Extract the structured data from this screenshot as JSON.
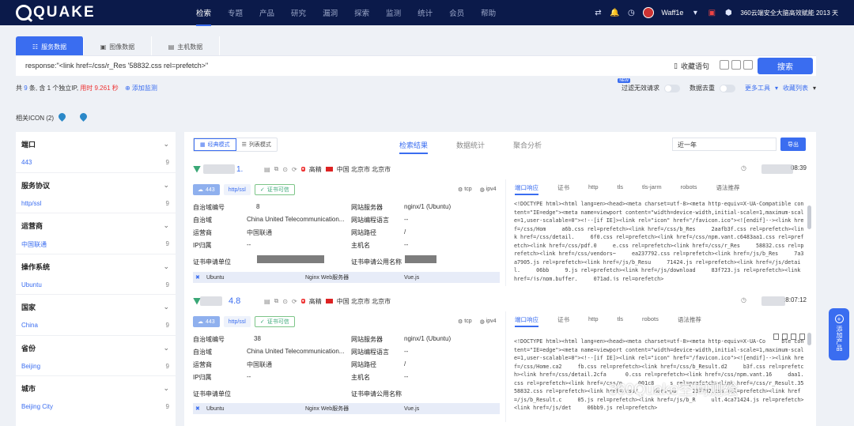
{
  "brand": {
    "name": "QUAKE"
  },
  "nav": {
    "items": [
      "检索",
      "专题",
      "产品",
      "研究",
      "漏洞",
      "探索",
      "监测",
      "统计",
      "会员",
      "帮助"
    ],
    "user": "Waff1e",
    "promo": "360云端安全大脑高效赋能 2013 天"
  },
  "search": {
    "tabs": [
      "服务数据",
      "图像数据",
      "主机数据"
    ],
    "query": "response:\"<link href=/css/r_Res        '58832.css rel=prefetch>\"",
    "fav_label": "收藏语句",
    "button": "搜索"
  },
  "stats": {
    "prefix": "共",
    "count": "9",
    "mid": "条, 含",
    "ip_count": "1",
    "ip_suffix": "个独立IP,",
    "time": "用时 9.261 秒",
    "add_monitor": "添加监测"
  },
  "filters": {
    "new_badge": "NEW",
    "filter_invalid": "过滤无效请求",
    "dedup": "数据去重",
    "more_tools": "更多工具",
    "fav_list": "收藏列表"
  },
  "related_icon": "相关ICON (2)",
  "sidebar": [
    {
      "head": "端口",
      "value": "443",
      "count": "9"
    },
    {
      "head": "服务协议",
      "value": "http/ssl",
      "count": "9"
    },
    {
      "head": "运营商",
      "value": "中国联通",
      "count": "9"
    },
    {
      "head": "操作系统",
      "value": "Ubuntu",
      "count": "9"
    },
    {
      "head": "国家",
      "value": "China",
      "count": "9"
    },
    {
      "head": "省份",
      "value": "Beijing",
      "count": "9"
    },
    {
      "head": "城市",
      "value": "Beijing City",
      "count": "9"
    }
  ],
  "results": {
    "modes": [
      "经典模式",
      "列表模式"
    ],
    "tabs": [
      "检索结果",
      "数据统计",
      "聚合分析"
    ],
    "date": "近一年",
    "export": "导出"
  },
  "cards": [
    {
      "ip": "1.",
      "tag": "高精",
      "location": "中国 北京市 北京市",
      "time": "08:39",
      "port": "443",
      "service": "http/ssl",
      "cert": "证书可信",
      "proto1": "tcp",
      "proto2": "ipv4",
      "fields": {
        "asn_label": "自治域编号",
        "asn": "8",
        "as_label": "自治域",
        "as": "China United Telecommunication...",
        "isp_label": "运营商",
        "isp": "中国联通",
        "ipreg_label": "IP归属",
        "ipreg": "--",
        "cert_unit_label": "证书申请单位",
        "server_label": "网站服务器",
        "server": "nginx/1       (Ubuntu)",
        "lang_label": "网站编程语言",
        "lang": "--",
        "path_label": "网站路径",
        "path": "/",
        "host_label": "主机名",
        "host": "--",
        "cert_cn_label": "证书申请公用名称"
      },
      "apps": [
        "Ubuntu",
        "Nginx Web服务器",
        "Vue.js"
      ],
      "rtabs": [
        "端口响应",
        "证书",
        "http",
        "tls",
        "tls-jarm",
        "robots",
        "语法推荐"
      ],
      "code": "<!DOCTYPE html><html lang=en><head><meta charset=utf-8><meta http-equiv=X-UA-Compatible content=\"IE=edge\"><meta name=viewport content=\"width=device-width,initial-scale=1,maximum-scale=1,user-scalable=0\"><!--[if IE]><link rel=\"icon\" href=\"/favicon.ico\"><![endif]--><link href=/css/Hom     a6b.css rel=prefetch><link href=/css/b_Res     2aafb3f.css rel=prefetch><link href=/css/detail.     6f0.css rel=prefetch><link href=/css/npm.vant.c6483aa1.css rel=prefetch><link href=/css/pdf.0     e.css rel=prefetch><link href=/css/r_Res     58832.css rel=prefetch><link href=/css/vendors~     ea237792.css rel=prefetch><link href=/js/b_Res     7a3a7905.js rel=prefetch><link href=/js/b_Resu     71424.js rel=prefetch><link href=/js/detail.     06bb     9.js rel=prefetch><link href=/js/download     83f723.js rel=prefetch><link href=/js/npm.buffer.     071ad.js rel=prefetch>"
    },
    {
      "ip": "4.8",
      "tag": "高精",
      "location": "中国 北京市 北京市",
      "time": ":8:07:12",
      "port": "443",
      "service": "http/ssl",
      "cert": "证书可信",
      "proto1": "tcp",
      "proto2": "ipv4",
      "fields": {
        "asn_label": "自治域编号",
        "asn": "38",
        "as_label": "自治域",
        "as": "China United Telecommunication...",
        "isp_label": "运营商",
        "isp": "中国联通",
        "ipreg_label": "IP归属",
        "ipreg": "--",
        "cert_unit_label": "证书申请单位",
        "server_label": "网站服务器",
        "server": "nginx/1      (Ubuntu)",
        "lang_label": "网站编程语言",
        "lang": "--",
        "path_label": "网站路径",
        "path": "/",
        "host_label": "主机名",
        "host": "--",
        "cert_cn_label": "证书申请公用名称"
      },
      "apps": [
        "Ubuntu",
        "Nginx Web服务器",
        "Vue.js"
      ],
      "rtabs": [
        "端口响应",
        "证书",
        "http",
        "tls",
        "robots",
        "语法推荐"
      ],
      "code": "<!DOCTYPE html><html lang=en><head><meta charset=utf-8><meta http-equiv=X-UA-Co     ble content=\"IE=edge\"><meta name=viewport content=\"width=device-width,initial-scale=1,maximum-scale=1,user-scalable=0\"><!--[if IE]><link rel=\"icon\" href=\"/favicon.ico\"><![endif]--><link href=/css/Home.ca2     fb.css rel=prefetch><link href=/css/b_Result.d2     b3f.css rel=prefetch><link href=/css/detail.2cfa      0.css rel=prefetch><link href=/css/npm.vant.16     daa1.css rel=prefetch><link href=/css/p     001c8     s rel=prefetch><link href=/css/r_Result.35     58832.css rel=prefetch><link href=/css/     dors~pu     237792.css rel=prefetch><link href=/js/b_Result.c     05.js rel=prefetch><link href=/js/b_R     ult.4ca71424.js rel=prefetch><link href=/js/det     06bb9.js rel=prefetch>"
    }
  ],
  "add_product": "添加产品",
  "watermark": "360Quake空间测绘"
}
